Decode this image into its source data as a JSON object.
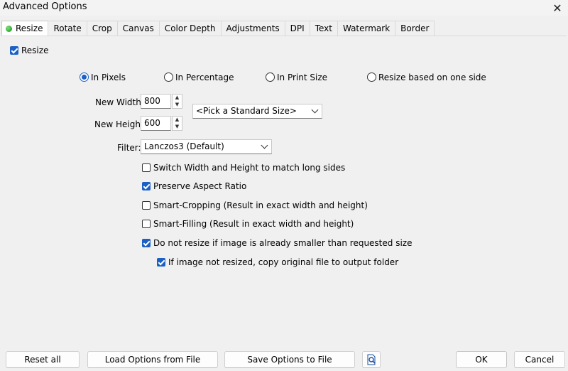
{
  "window": {
    "title": "Advanced Options"
  },
  "tabs": [
    "Resize",
    "Rotate",
    "Crop",
    "Canvas",
    "Color Depth",
    "Adjustments",
    "DPI",
    "Text",
    "Watermark",
    "Border"
  ],
  "resize": {
    "enable_label": "Resize",
    "enabled": true,
    "modes": [
      {
        "label": "In Pixels",
        "selected": true
      },
      {
        "label": "In Percentage",
        "selected": false
      },
      {
        "label": "In Print Size",
        "selected": false
      },
      {
        "label": "Resize based on one side",
        "selected": false
      }
    ],
    "width_label": "New Width:",
    "width_value": "800",
    "height_label": "New Height:",
    "height_value": "600",
    "standard_size": "<Pick a Standard Size>",
    "filter_label": "Filter:",
    "filter_value": "Lanczos3 (Default)",
    "options": [
      {
        "label": "Switch Width and Height to match long sides",
        "checked": false
      },
      {
        "label": "Preserve Aspect Ratio",
        "checked": true
      },
      {
        "label": "Smart-Cropping (Result in exact width and height)",
        "checked": false
      },
      {
        "label": "Smart-Filling (Result in exact width and height)",
        "checked": false
      },
      {
        "label": "Do not resize if image is already smaller than requested size",
        "checked": true
      },
      {
        "label": "If image not resized, copy original file to output folder",
        "checked": true
      }
    ]
  },
  "footer": {
    "reset": "Reset all",
    "load": "Load Options from File",
    "save": "Save Options to File",
    "preview_icon": "magnifier-document-icon",
    "ok": "OK",
    "cancel": "Cancel"
  },
  "colors": {
    "accent": "#1a60c5",
    "active_dot": "#22b022"
  }
}
